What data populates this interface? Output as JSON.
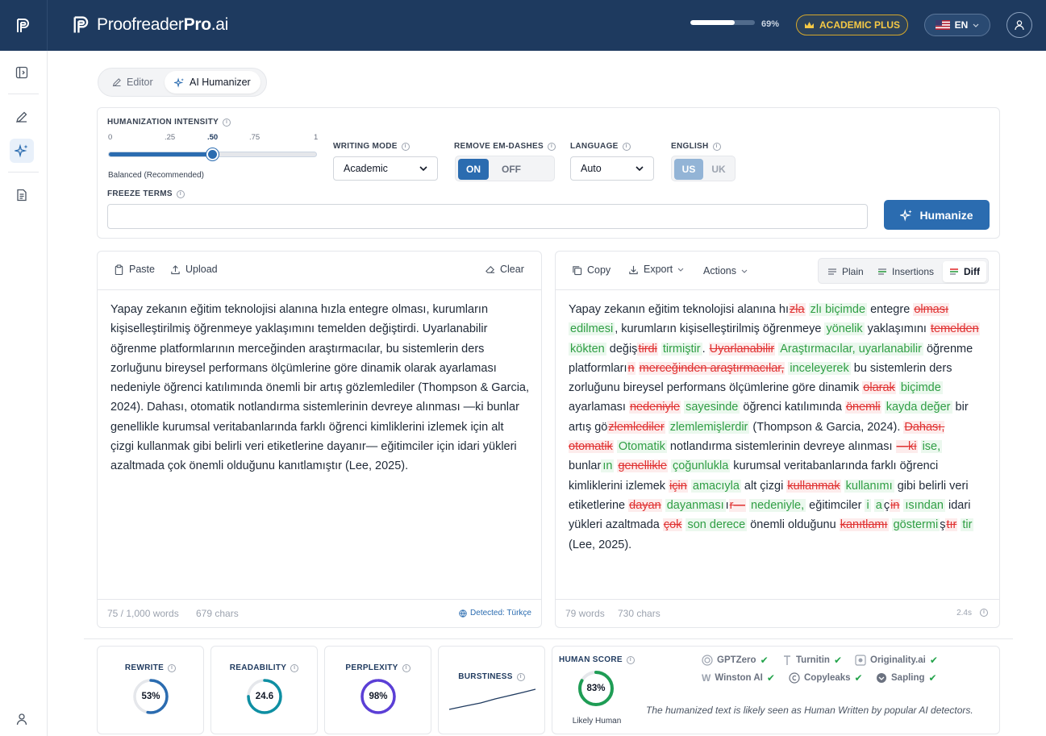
{
  "header": {
    "brand_main": "Proofreader",
    "brand_bold": "Pro",
    "brand_suffix": ".ai",
    "usage_percent": "69%",
    "usage_fraction": 0.69,
    "plan": "ACADEMIC PLUS",
    "language": "EN"
  },
  "mode_tabs": [
    {
      "label": "Editor",
      "active": false
    },
    {
      "label": "AI Humanizer",
      "active": true
    }
  ],
  "settings": {
    "intensity_label": "HUMANIZATION INTENSITY",
    "ticks": [
      "0",
      ".25",
      ".50",
      ".75",
      "1"
    ],
    "intensity_value": 0.5,
    "intensity_caption": "Balanced (Recommended)",
    "writing_mode_label": "WRITING MODE",
    "writing_mode_value": "Academic",
    "em_dash_label": "REMOVE EM-DASHES",
    "em_dash_on": "ON",
    "em_dash_off": "OFF",
    "language_label": "LANGUAGE",
    "language_value": "Auto",
    "english_label": "ENGLISH",
    "english_us": "US",
    "english_uk": "UK",
    "freeze_label": "FREEZE TERMS",
    "freeze_value": "",
    "humanize_button": "Humanize"
  },
  "input_panel": {
    "paste": "Paste",
    "upload": "Upload",
    "clear": "Clear",
    "text": "Yapay zekanın eğitim teknolojisi alanına hızla entegre olması, kurumların kişiselleştirilmiş öğrenmeye yaklaşımını temelden değiştirdi. Uyarlanabilir öğrenme platformlarının merceğinden araştırmacılar, bu sistemlerin ders zorluğunu bireysel performans ölçümlerine göre dinamik olarak ayarlaması nedeniyle öğrenci katılımında önemli bir artış gözlemlediler (Thompson & Garcia, 2024). Dahası, otomatik notlandırma sistemlerinin devreye alınması —ki bunlar genellikle kurumsal veritabanlarında farklı öğrenci kimliklerini izlemek için alt çizgi kullanmak gibi belirli veri etiketlerine dayanır— eğitimciler için idari yükleri azaltmada çok önemli olduğunu kanıtlamıştır (Lee, 2025).",
    "word_count": "75 / 1,000 words",
    "char_count": "679 chars",
    "detected": "Detected: Türkçe"
  },
  "output_panel": {
    "copy": "Copy",
    "export": "Export",
    "actions": "Actions",
    "view_plain": "Plain",
    "view_insertions": "Insertions",
    "view_diff": "Diff",
    "word_count": "79 words",
    "char_count": "730 chars",
    "time": "2.4s",
    "segments": [
      {
        "t": "Yapay zekanın eğitim teknolojisi alanına hı",
        "k": "n"
      },
      {
        "t": "zla",
        "k": "d"
      },
      {
        "t": " ",
        "k": "n"
      },
      {
        "t": "zlı biçimde",
        "k": "i"
      },
      {
        "t": " entegre ",
        "k": "n"
      },
      {
        "t": "olması",
        "k": "d"
      },
      {
        "t": " ",
        "k": "n"
      },
      {
        "t": "edilmesi",
        "k": "i"
      },
      {
        "t": ", kurumların kişiselleştirilmiş öğrenmeye ",
        "k": "n"
      },
      {
        "t": "yönelik",
        "k": "i"
      },
      {
        "t": " yaklaşımını ",
        "k": "n"
      },
      {
        "t": "temelden",
        "k": "d"
      },
      {
        "t": " ",
        "k": "n"
      },
      {
        "t": "kökten",
        "k": "i"
      },
      {
        "t": " değiş",
        "k": "n"
      },
      {
        "t": "tirdi",
        "k": "d"
      },
      {
        "t": " ",
        "k": "n"
      },
      {
        "t": "tirmiştir",
        "k": "i"
      },
      {
        "t": ". ",
        "k": "n"
      },
      {
        "t": "Uyarlanabilir",
        "k": "d"
      },
      {
        "t": " ",
        "k": "n"
      },
      {
        "t": "Araştırmacılar, uyarlanabilir",
        "k": "i"
      },
      {
        "t": " öğrenme platformları",
        "k": "n"
      },
      {
        "t": "n",
        "k": "d"
      },
      {
        "t": " ",
        "k": "n"
      },
      {
        "t": "merceğinden araştırmacılar,",
        "k": "d"
      },
      {
        "t": " ",
        "k": "n"
      },
      {
        "t": "inceleyerek",
        "k": "i"
      },
      {
        "t": " bu sistemlerin ders zorluğunu bireysel performans ölçümlerine göre dinamik ",
        "k": "n"
      },
      {
        "t": "olarak",
        "k": "d"
      },
      {
        "t": " ",
        "k": "n"
      },
      {
        "t": "biçimde",
        "k": "i"
      },
      {
        "t": " ayarlaması ",
        "k": "n"
      },
      {
        "t": "nedeniyle",
        "k": "d"
      },
      {
        "t": " ",
        "k": "n"
      },
      {
        "t": "sayesinde",
        "k": "i"
      },
      {
        "t": " öğrenci katılımında ",
        "k": "n"
      },
      {
        "t": "önemli",
        "k": "d"
      },
      {
        "t": " ",
        "k": "n"
      },
      {
        "t": "kayda değer",
        "k": "i"
      },
      {
        "t": " bir artış gö",
        "k": "n"
      },
      {
        "t": "zlemlediler",
        "k": "d"
      },
      {
        "t": " ",
        "k": "n"
      },
      {
        "t": "zlemlemişlerdir",
        "k": "i"
      },
      {
        "t": " (Thompson & Garcia, 2024). ",
        "k": "n"
      },
      {
        "t": "Dahası, otomatik",
        "k": "d"
      },
      {
        "t": " ",
        "k": "n"
      },
      {
        "t": "Otomatik",
        "k": "i"
      },
      {
        "t": " notlandırma sistemlerinin devreye alınması ",
        "k": "n"
      },
      {
        "t": "—ki",
        "k": "d"
      },
      {
        "t": " ",
        "k": "n"
      },
      {
        "t": "ise,",
        "k": "i"
      },
      {
        "t": " bunlar",
        "k": "n"
      },
      {
        "t": "ın",
        "k": "i"
      },
      {
        "t": " ",
        "k": "n"
      },
      {
        "t": "genellikle",
        "k": "d"
      },
      {
        "t": " ",
        "k": "n"
      },
      {
        "t": "çoğunlukla",
        "k": "i"
      },
      {
        "t": " kurumsal veritabanlarında farklı öğrenci kimliklerini izlemek ",
        "k": "n"
      },
      {
        "t": "için",
        "k": "d"
      },
      {
        "t": " ",
        "k": "n"
      },
      {
        "t": "amacıyla",
        "k": "i"
      },
      {
        "t": " alt çizgi ",
        "k": "n"
      },
      {
        "t": "kullanmak",
        "k": "d"
      },
      {
        "t": " ",
        "k": "n"
      },
      {
        "t": "kullanımı",
        "k": "i"
      },
      {
        "t": " gibi belirli veri etiketlerine ",
        "k": "n"
      },
      {
        "t": "dayan",
        "k": "d"
      },
      {
        "t": " ",
        "k": "n"
      },
      {
        "t": "dayanması",
        "k": "i"
      },
      {
        "t": "ı",
        "k": "n"
      },
      {
        "t": "r—",
        "k": "d"
      },
      {
        "t": " ",
        "k": "n"
      },
      {
        "t": "nedeniyle,",
        "k": "i"
      },
      {
        "t": " eğitimciler ",
        "k": "n"
      },
      {
        "t": "i",
        "k": "i"
      },
      {
        "t": " ",
        "k": "n"
      },
      {
        "t": "a",
        "k": "i"
      },
      {
        "t": "ç",
        "k": "n"
      },
      {
        "t": "in",
        "k": "d"
      },
      {
        "t": " ",
        "k": "n"
      },
      {
        "t": "ısından",
        "k": "i"
      },
      {
        "t": " idari yükleri azaltmada ",
        "k": "n"
      },
      {
        "t": "çok",
        "k": "d"
      },
      {
        "t": " ",
        "k": "n"
      },
      {
        "t": "son derece",
        "k": "i"
      },
      {
        "t": " önemli olduğunu ",
        "k": "n"
      },
      {
        "t": "kanıtlamı",
        "k": "d"
      },
      {
        "t": " ",
        "k": "n"
      },
      {
        "t": "göstermi",
        "k": "i"
      },
      {
        "t": "ş",
        "k": "n"
      },
      {
        "t": "tır",
        "k": "d"
      },
      {
        "t": " ",
        "k": "n"
      },
      {
        "t": "tir",
        "k": "i"
      },
      {
        "t": " (Lee, 2025).",
        "k": "n"
      }
    ]
  },
  "metrics": {
    "rewrite_label": "REWRITE",
    "rewrite_value": "53%",
    "rewrite_fraction": 0.53,
    "readability_label": "READABILITY",
    "readability_value": "24.6",
    "readability_fraction": 0.75,
    "perplexity_label": "PERPLEXITY",
    "perplexity_value": "98%",
    "perplexity_fraction": 0.98,
    "burstiness_label": "BURSTINESS",
    "human_score_label": "HUMAN SCORE",
    "human_score_value": "83%",
    "human_score_fraction": 0.83,
    "human_score_caption": "Likely Human",
    "detectors": [
      "GPTZero",
      "Turnitin",
      "Originality.ai",
      "Winston AI",
      "Copyleaks",
      "Sapling"
    ],
    "note": "The humanized text is likely seen as Human Written by popular AI detectors.",
    "colors": {
      "rewrite": "#2b6cb0",
      "readability": "#0e8fa3",
      "perplexity": "#5b3fd6",
      "human": "#1f9d55"
    }
  }
}
